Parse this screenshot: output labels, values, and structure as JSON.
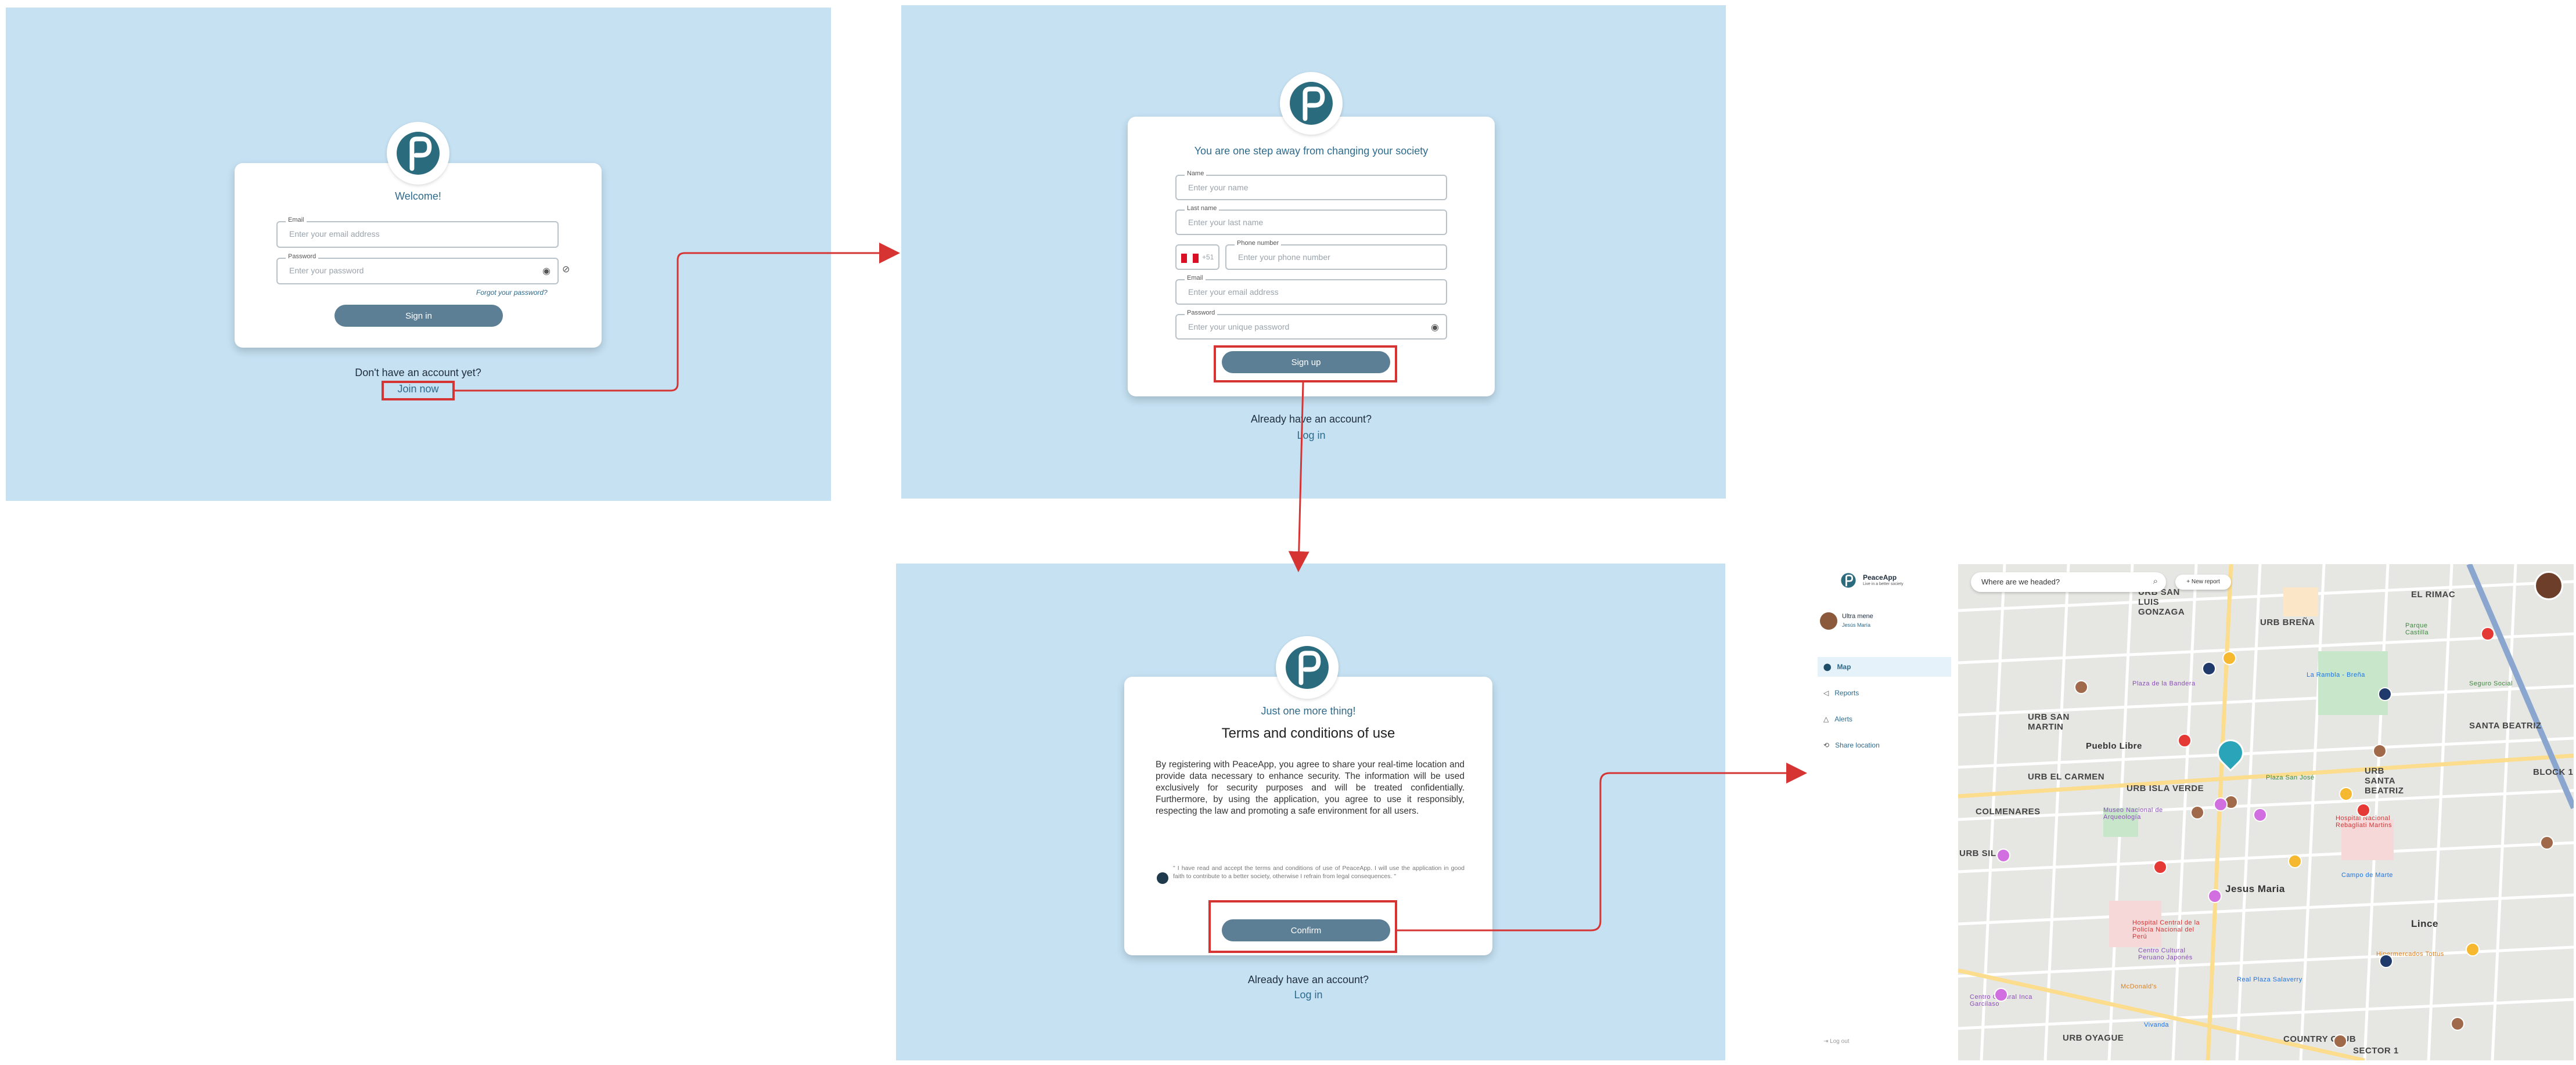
{
  "signin": {
    "welcome": "Welcome!",
    "email_label": "Email",
    "email_placeholder": "Enter your email address",
    "password_label": "Password",
    "password_placeholder": "Enter your password",
    "forgot": "Forgot your password?",
    "signin_button": "Sign in",
    "no_account": "Don't have an account yet?",
    "join_now": "Join now"
  },
  "signup": {
    "title": "You are one step away from changing your society",
    "name_label": "Name",
    "name_placeholder": "Enter your name",
    "lastname_label": "Last name",
    "lastname_placeholder": "Enter your last name",
    "country_code": "+51",
    "phone_label": "Phone number",
    "phone_placeholder": "Enter your phone number",
    "email_label": "Email",
    "email_placeholder": "Enter your email address",
    "password_label": "Password",
    "password_placeholder": "Enter your unique password",
    "signup_button": "Sign up",
    "have_account": "Already have an account?",
    "login": "Log in"
  },
  "terms": {
    "subtitle": "Just one more thing!",
    "title": "Terms and conditions of use",
    "body": "By registering with PeaceApp, you agree to share your real-time location and provide data necessary to enhance security. The information will be used exclusively for security purposes and will be treated confidentially. Furthermore, by using the application, you agree to use it responsibly, respecting the law and promoting a safe environment for all users.",
    "checkbox_text": "\" I have read and accept the terms and conditions of use of PeaceApp. I will use the application in good faith to contribute to a better society, otherwise I refrain from legal consequences. \"",
    "confirm_button": "Confirm",
    "have_account": "Already have an account?",
    "login": "Log in"
  },
  "app": {
    "brand": "PeaceApp",
    "tagline": "Live in a better society",
    "user_name": "Ultra mene",
    "user_district": "Jesús María",
    "nav": [
      "Map",
      "Reports",
      "Alerts",
      "Share location"
    ],
    "logout": "Log out",
    "search_placeholder": "Where are we headed?",
    "new_report": "+ New report",
    "map_labels": [
      "URB SAN LUIS GONZAGA",
      "URB BREÑA",
      "EL RIMAC",
      "URB SAN MARTIN",
      "Pueblo Libre",
      "URB ISLA VERDE",
      "URB EL CARMEN",
      "COLMENARES",
      "URB SANTA BEATRIZ",
      "SANTA BEATRIZ",
      "Jesus Maria",
      "Lince",
      "URB OYAGUE",
      "COUNTRY CLUB",
      "SECTOR 1",
      "URB SIL",
      "BLOCK 1",
      "Plaza San José",
      "Museo Nacional de Arqueología",
      "Hospital Central de la Policía Nacional del Perú",
      "Hospital Nacional Rebagliati Martins",
      "Centro Cultural Peruano Japonés",
      "Real Plaza Salaverry",
      "Centro Cultural Inca Garcilaso",
      "Campo de Marte",
      "Parque Castilla",
      "McDonald's",
      "Vivanda",
      "Plaza de la Bandera",
      "La Rambla - Breña",
      "Hipermercados Tottus",
      "Seguro Social"
    ]
  },
  "colors": {
    "panel_bg": "#c5e1f2",
    "accent": "#2d6a8c",
    "button": "#5c7f96",
    "highlight": "#d63333"
  }
}
